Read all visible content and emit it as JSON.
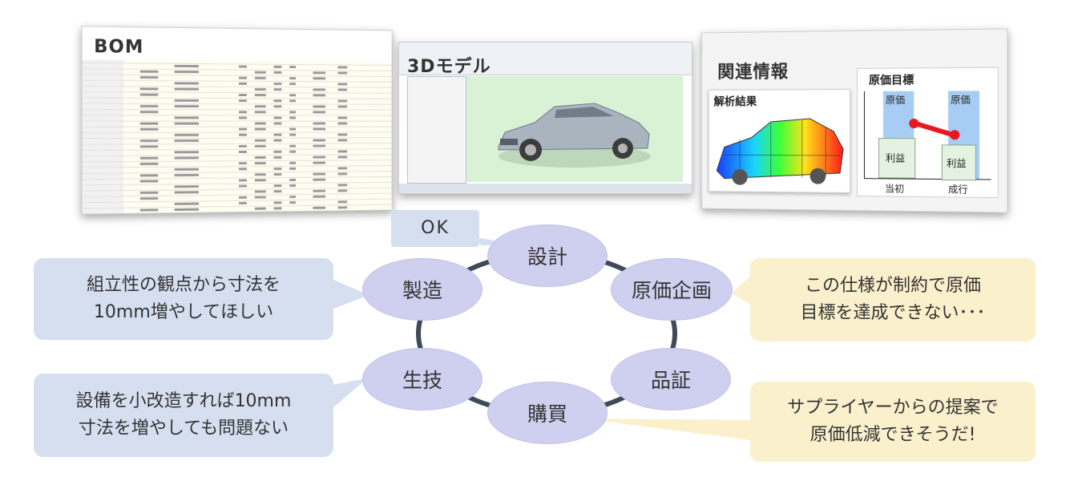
{
  "panels": {
    "bom": {
      "title": "BOM"
    },
    "model3d": {
      "title": "3Dモデル"
    },
    "related": {
      "title": "関連情報",
      "analysis_title": "解析結果",
      "cost_target": {
        "title": "原価目標",
        "bar_label_cost": "原価",
        "bar_label_profit": "利益",
        "x_labels": [
          "当初",
          "成行"
        ]
      }
    }
  },
  "nodes": {
    "design": "設計",
    "cost_planning": "原価企画",
    "quality": "品証",
    "purchasing": "購買",
    "production_eng": "生技",
    "manufacturing": "製造"
  },
  "callouts": {
    "ok": "OK",
    "manufacturing": "組立性の観点から寸法を\n10mm増やしてほしい",
    "cost_planning": "この仕様が制約で原価\n目標を達成できない･･･",
    "production_eng": "設備を小改造すれば10mm\n寸法を増やしても問題ない",
    "purchasing": "サプライヤーからの提案で\n原価低減できそうだ!"
  },
  "colors": {
    "node_fill": "#cfcff0",
    "blue_callout": "#d6dff0",
    "yellow_callout": "#fbf0cc",
    "cycle_line": "#3d4a58"
  }
}
